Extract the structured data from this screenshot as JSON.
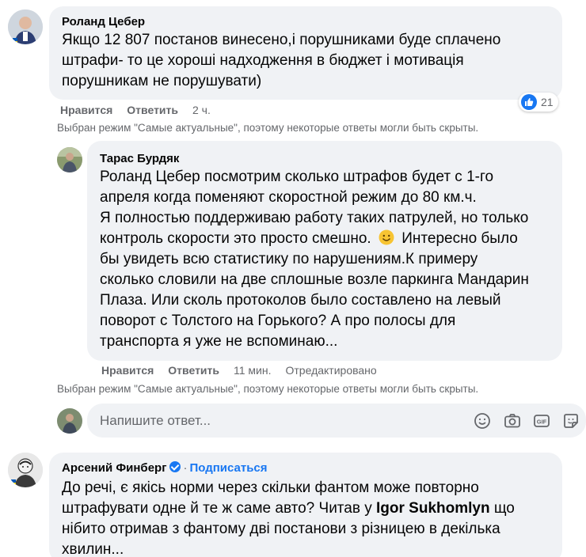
{
  "comment1": {
    "author": "Роланд Цебер",
    "lines": [
      "Якщо 12 807 постанов винесено,і порушниками буде сплачено",
      "штрафи- то це хороші надходження в бюджет і мотивація",
      "порушникам не порушувати)"
    ],
    "like_label": "Нравится",
    "reply_label": "Ответить",
    "time": "2 ч.",
    "reaction_count": "21",
    "filter_note": "Выбран режим \"Самые актуальные\", поэтому некоторые ответы могли быть скрыты."
  },
  "reply1": {
    "author": "Тарас Бурдяк",
    "lines": [
      "Роланд Цебер посмотрим сколько штрафов будет с 1-го",
      "апреля когда поменяют скоростной режим до 80 км.ч.",
      "Я полностью поддерживаю работу таких патрулей, но только",
      "контроль скорости это просто смешно.",
      "Интересно было",
      "бы увидеть всю статистику по нарушениям.К примеру",
      "сколько словили на две сплошные возле паркинга Мандарин",
      "Плаза. Или сколь протоколов было составлено на левый",
      "поворот с Толстого на Горького? А про полосы для",
      "транспорта я уже не вспоминаю..."
    ],
    "like_label": "Нравится",
    "reply_label": "Ответить",
    "time": "11 мин.",
    "edited": "Отредактировано",
    "filter_note": "Выбран режим \"Самые актуальные\", поэтому некоторые ответы могли быть скрыты."
  },
  "reply_box": {
    "placeholder": "Напишите ответ..."
  },
  "comment2": {
    "author": "Арсений Финберг",
    "dot": "·",
    "follow_label": "Подписаться",
    "line1": "До речі, є якісь норми через скільки фантом може повторно",
    "line2_pre": "штрафувати одне й те ж саме авто? Читав у ",
    "mention": "Igor Sukhomlyn",
    "line2_post": " що",
    "line3": "нібито отримав з фантому дві постанови з різницею в декілька",
    "line4": "хвилин..."
  },
  "colors": {
    "bubble": "#f0f2f5",
    "meta_text": "#65676b",
    "accent": "#1877f2"
  }
}
